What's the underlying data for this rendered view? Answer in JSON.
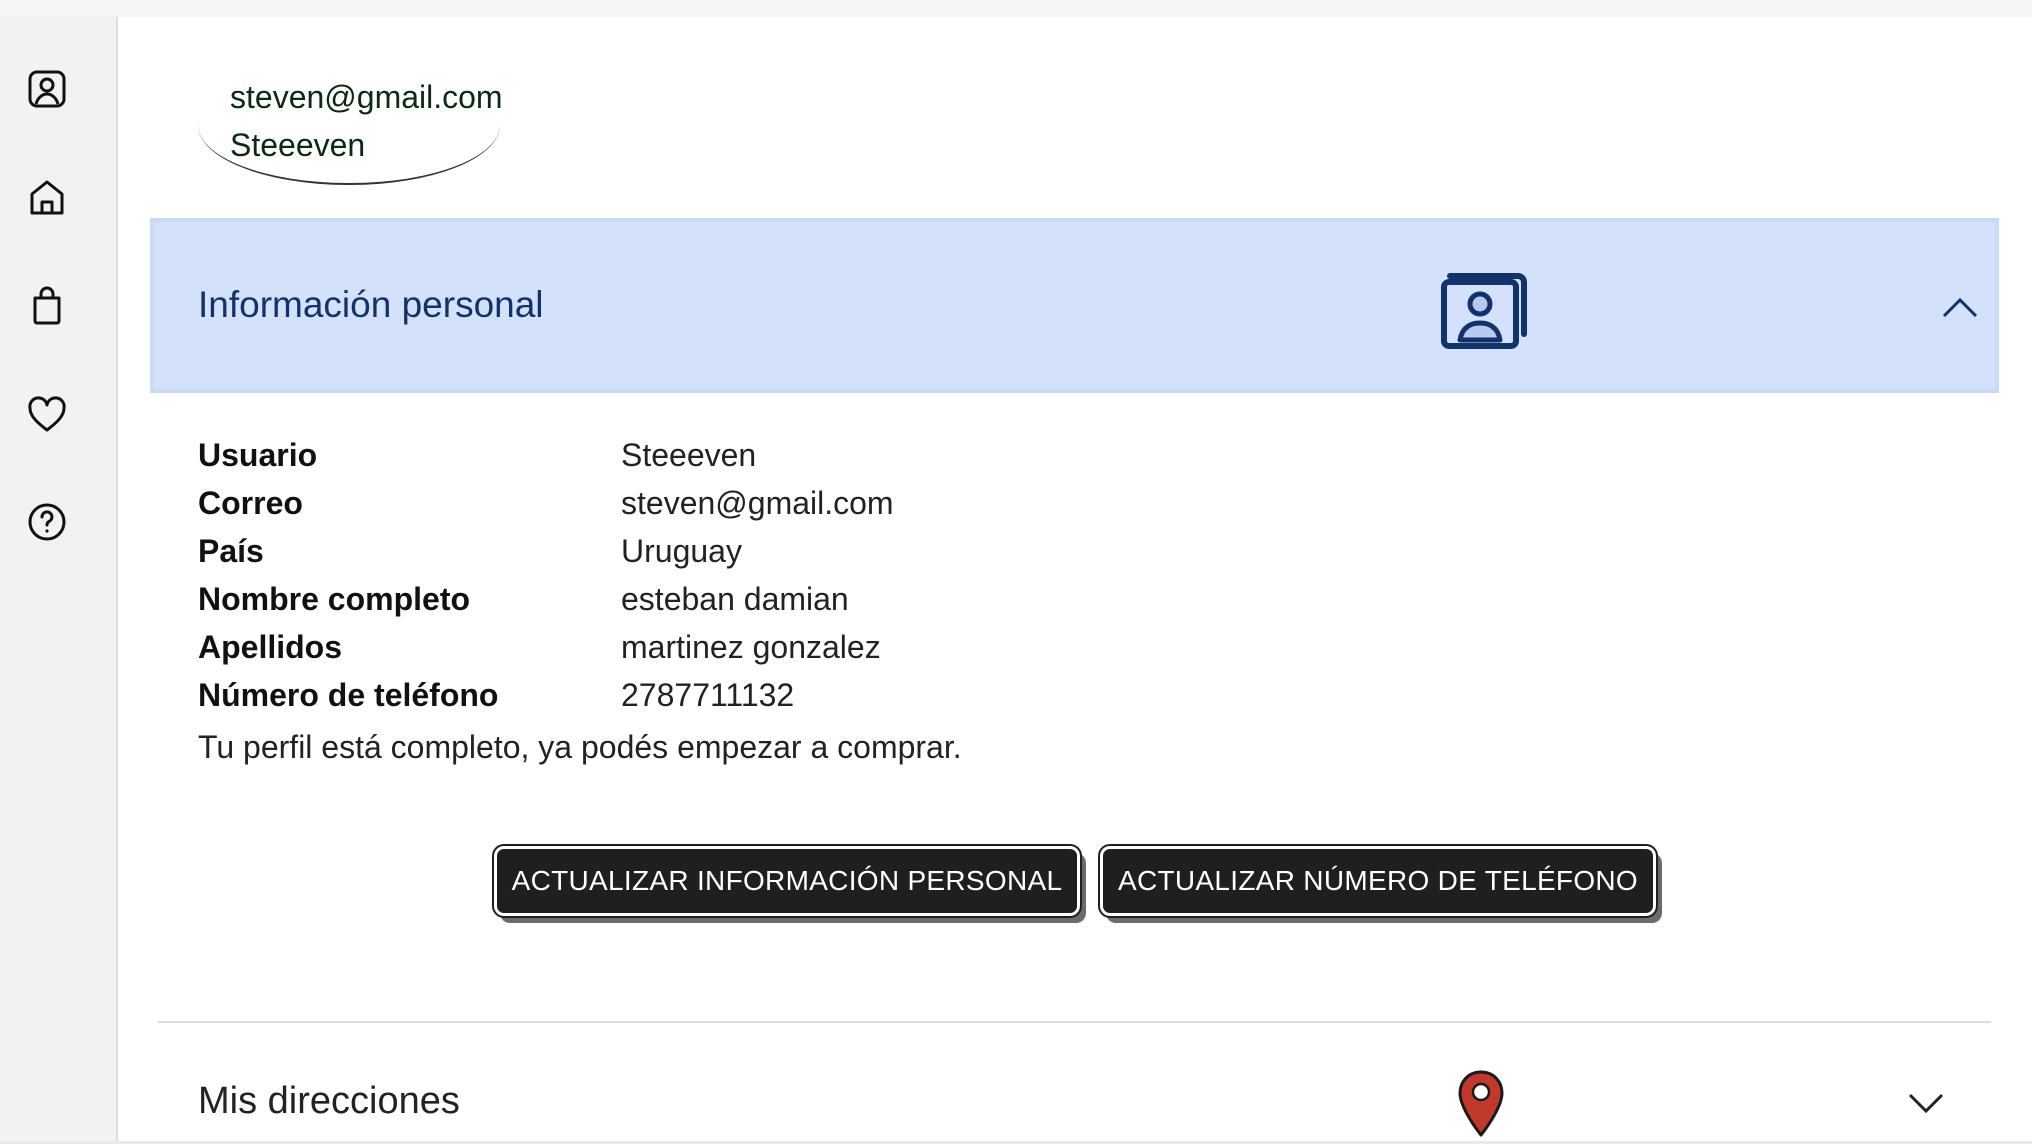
{
  "sidebar": {
    "icons": [
      "user-profile-icon",
      "home-icon",
      "shopping-bag-icon",
      "heart-icon",
      "help-icon"
    ]
  },
  "user_card": {
    "email": "steven@gmail.com",
    "username": "Steeeven"
  },
  "personal_section": {
    "title": "Información personal",
    "icon": "contact-card-icon",
    "expanded": true,
    "accent_bg": "#d3e1fb",
    "title_color": "#12326b",
    "fields": [
      {
        "label": "Usuario",
        "value": "Steeeven"
      },
      {
        "label": "Correo",
        "value": "steven@gmail.com"
      },
      {
        "label": "País",
        "value": "Uruguay"
      },
      {
        "label": "Nombre completo",
        "value": "esteban damian"
      },
      {
        "label": "Apellidos",
        "value": "martinez gonzalez"
      },
      {
        "label": "Número de teléfono",
        "value": "2787711132"
      }
    ],
    "status_message": "Tu perfil está completo, ya podés empezar a comprar.",
    "buttons": {
      "update_personal": "ACTUALIZAR INFORMACIÓN PERSONAL",
      "update_phone": "ACTUALIZAR NÚMERO DE TELÉFONO"
    }
  },
  "addresses_section": {
    "title": "Mis direcciones",
    "icon": "map-pin-icon",
    "expanded": false,
    "pin_color": "#c0392b"
  }
}
